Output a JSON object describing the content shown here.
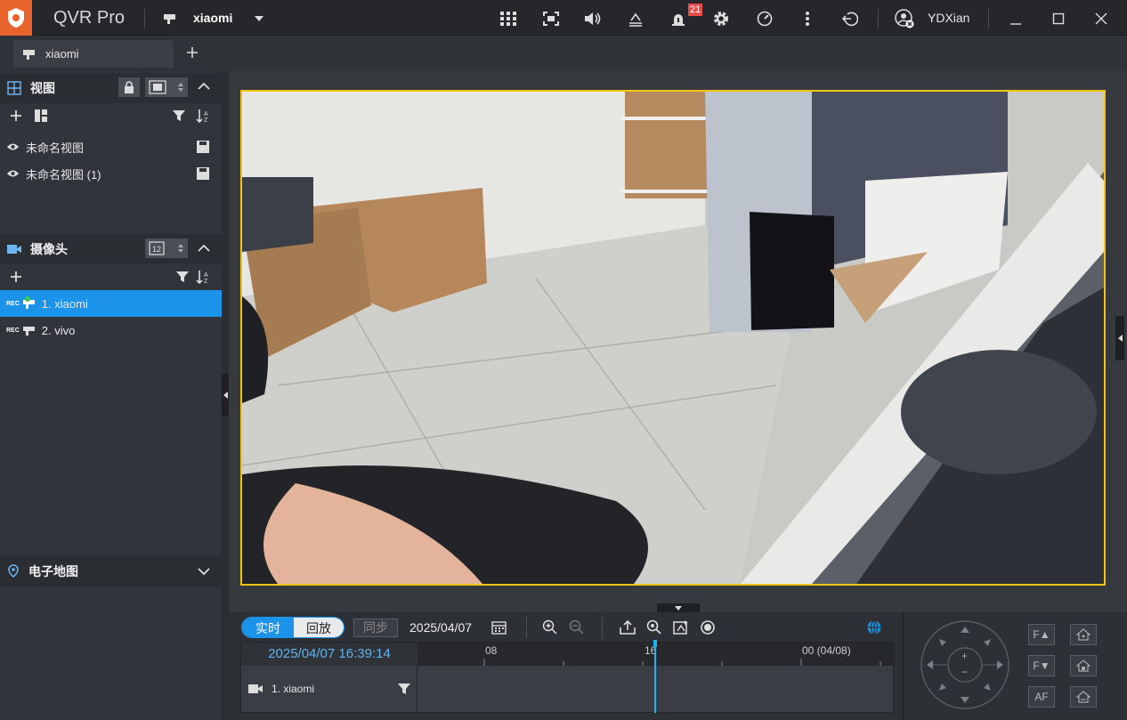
{
  "app": {
    "title": "QVR Pro",
    "server": "xiaomi",
    "user": "YDXian",
    "notification_count": "21"
  },
  "tabs": [
    {
      "label": "xiaomi"
    }
  ],
  "views_section": {
    "title": "视图",
    "items": [
      {
        "label": "未命名视图"
      },
      {
        "label": "未命名视图 (1)"
      }
    ]
  },
  "camera_section": {
    "title": "摄像头",
    "items": [
      {
        "label": "1. xiaomi",
        "selected": true,
        "rec": "REC"
      },
      {
        "label": "2. vivo",
        "selected": false,
        "rec": "REC"
      }
    ]
  },
  "emap_section": {
    "title": "电子地图"
  },
  "playback": {
    "mode_live": "实时",
    "mode_playback": "回放",
    "sync": "同步",
    "date": "2025/04/07",
    "current_time": "2025/04/07 16:39:14",
    "tick_labels": [
      "08",
      "16",
      "00 (04/08)"
    ],
    "camera_row": "1. xiaomi"
  },
  "ptz": {
    "zoom_plus": "+",
    "zoom_minus": "−",
    "focus_up": "F▲",
    "focus_down": "F▼",
    "auto_focus": "AF"
  },
  "colors": {
    "accent": "#1b93e8",
    "highlight": "#f2c515",
    "logo": "#e8622c",
    "badge": "#e94b4b"
  }
}
